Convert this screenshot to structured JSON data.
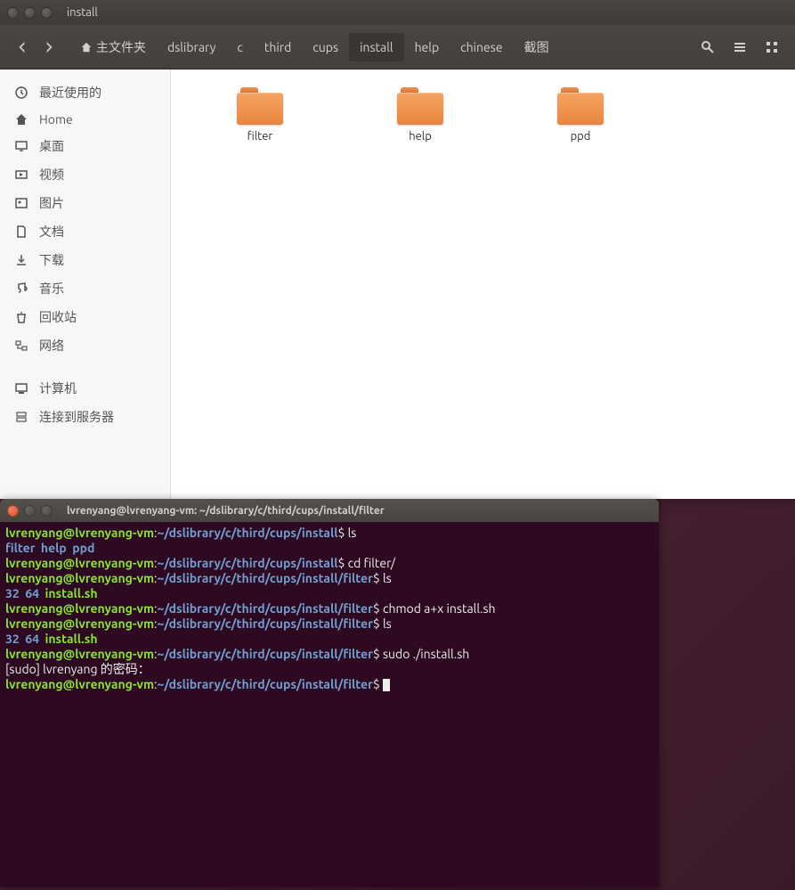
{
  "file_manager": {
    "title": "install",
    "breadcrumbs": [
      {
        "label": "主文件夹",
        "home": true
      },
      {
        "label": "dslibrary"
      },
      {
        "label": "c"
      },
      {
        "label": "third"
      },
      {
        "label": "cups"
      },
      {
        "label": "install",
        "active": true
      },
      {
        "label": "help"
      },
      {
        "label": "chinese"
      },
      {
        "label": "截图"
      }
    ],
    "sidebar": [
      {
        "label": "最近使用的",
        "icon": "clock"
      },
      {
        "label": "Home",
        "icon": "home"
      },
      {
        "label": "桌面",
        "icon": "desktop"
      },
      {
        "label": "视频",
        "icon": "video"
      },
      {
        "label": "图片",
        "icon": "image"
      },
      {
        "label": "文档",
        "icon": "doc"
      },
      {
        "label": "下载",
        "icon": "download"
      },
      {
        "label": "音乐",
        "icon": "music"
      },
      {
        "label": "回收站",
        "icon": "trash"
      },
      {
        "label": "网络",
        "icon": "network"
      },
      {
        "spacer": true
      },
      {
        "label": "计算机",
        "icon": "computer"
      },
      {
        "label": "连接到服务器",
        "icon": "server"
      }
    ],
    "folders": [
      {
        "label": "filter"
      },
      {
        "label": "help"
      },
      {
        "label": "ppd"
      }
    ]
  },
  "terminal": {
    "title": "lvrenyang@lvrenyang-vm: ~/dslibrary/c/third/cups/install/filter",
    "prompt_user": "lvrenyang@lvrenyang-vm",
    "prompt_colon": ":",
    "prompt_dollar": "$",
    "paths": {
      "install": "~/dslibrary/c/third/cups/install",
      "filter": "~/dslibrary/c/third/cups/install/filter"
    },
    "lines": [
      {
        "type": "prompt",
        "path": "install",
        "cmd": " ls"
      },
      {
        "type": "out",
        "spans": [
          {
            "cls": "t-dir",
            "t": "filter"
          },
          {
            "cls": "t-plain",
            "t": "  "
          },
          {
            "cls": "t-dir",
            "t": "help"
          },
          {
            "cls": "t-plain",
            "t": "  "
          },
          {
            "cls": "t-dir",
            "t": "ppd"
          }
        ]
      },
      {
        "type": "prompt",
        "path": "install",
        "cmd": " cd filter/"
      },
      {
        "type": "prompt",
        "path": "filter",
        "cmd": " ls"
      },
      {
        "type": "out",
        "spans": [
          {
            "cls": "t-dir",
            "t": "32"
          },
          {
            "cls": "t-plain",
            "t": "  "
          },
          {
            "cls": "t-dir",
            "t": "64"
          },
          {
            "cls": "t-plain",
            "t": "  "
          },
          {
            "cls": "t-exec",
            "t": "install.sh"
          }
        ]
      },
      {
        "type": "prompt",
        "path": "filter",
        "cmd": " chmod a+x install.sh"
      },
      {
        "type": "prompt",
        "path": "filter",
        "cmd": " ls"
      },
      {
        "type": "out",
        "spans": [
          {
            "cls": "t-dir",
            "t": "32"
          },
          {
            "cls": "t-plain",
            "t": "  "
          },
          {
            "cls": "t-dir",
            "t": "64"
          },
          {
            "cls": "t-plain",
            "t": "  "
          },
          {
            "cls": "t-exec",
            "t": "install.sh"
          }
        ]
      },
      {
        "type": "prompt",
        "path": "filter",
        "cmd": " sudo ./install.sh"
      },
      {
        "type": "out",
        "spans": [
          {
            "cls": "t-plain",
            "t": "[sudo] lvrenyang 的密码："
          }
        ]
      },
      {
        "type": "prompt",
        "path": "filter",
        "cmd": " ",
        "cursor": true
      }
    ]
  }
}
